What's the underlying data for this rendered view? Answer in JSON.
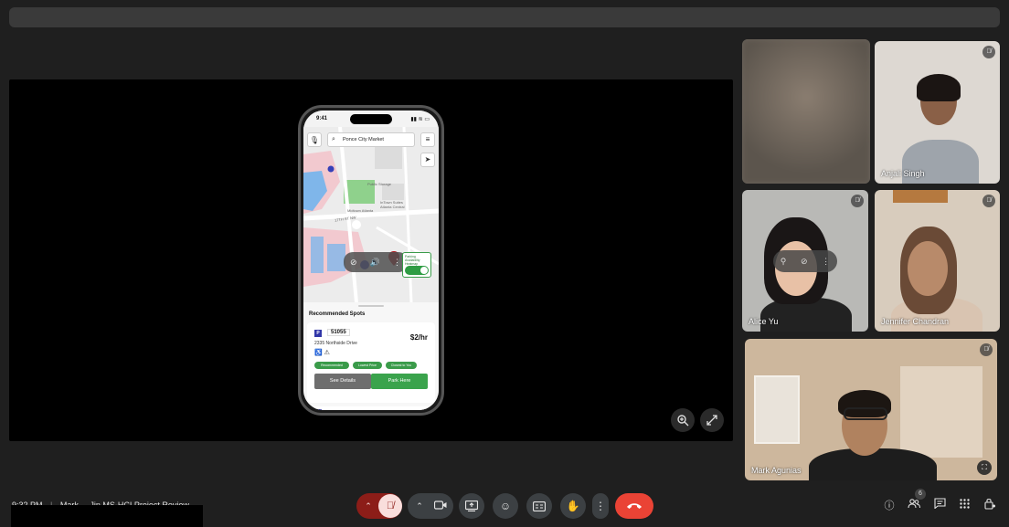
{
  "meeting": {
    "time": "9:32 PM",
    "separator": "|",
    "title": "Mark ... Jin MS-HCI Project Review"
  },
  "phone_app": {
    "status_time": "9:41",
    "search_text": "Ponce City Market",
    "map_labels": [
      "Public Storage",
      "InTown Suites Atlanta Central",
      "Midtown Atlanta",
      "17TH ST NW"
    ],
    "toggle_label": "Parking Availability Heatmap",
    "sheet_title": "Recommended Spots",
    "spot": {
      "badge": "P",
      "id": "51055",
      "address": "2335 Northside Drive",
      "price": "$2/hr",
      "tags": [
        "Recommended",
        "Lowest Price",
        "Closest to You"
      ],
      "details_button": "See Details",
      "park_button": "Park Here"
    }
  },
  "participants": [
    {
      "name": "",
      "muted": false
    },
    {
      "name": "Anjali Singh",
      "muted": true
    },
    {
      "name": "Alice Yu",
      "muted": true
    },
    {
      "name": "Jennifer Chandran",
      "muted": true
    },
    {
      "name": "Mark Agunias",
      "muted": true
    }
  ],
  "participant_count": "6",
  "colors": {
    "background": "#1f1f1f",
    "end_call": "#ea4335",
    "mic_off": "#f9dedc",
    "accent_green": "#3aa34c"
  }
}
